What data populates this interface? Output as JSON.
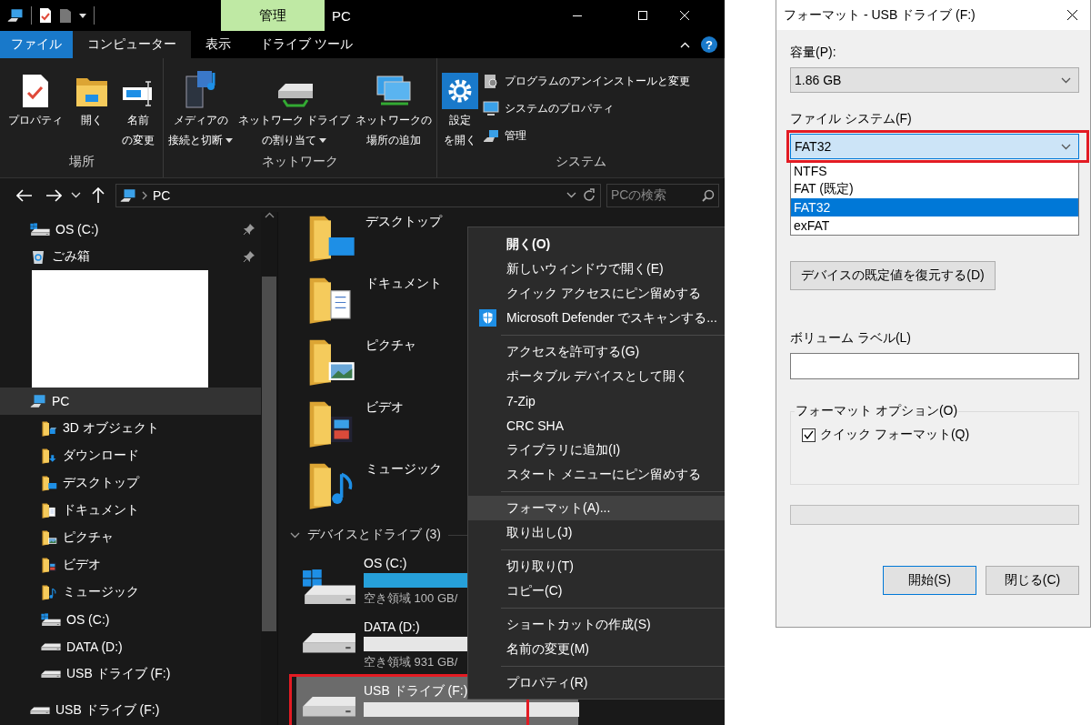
{
  "window": {
    "title": "PC",
    "context_tab": "管理",
    "help": "?"
  },
  "tabs": [
    {
      "label": "ファイル",
      "kind": "file",
      "selected": false
    },
    {
      "label": "コンピューター",
      "kind": "tab",
      "selected": true
    },
    {
      "label": "表示",
      "kind": "tab",
      "selected": false
    },
    {
      "label": "ドライブ ツール",
      "kind": "tab",
      "selected": false
    }
  ],
  "ribbon": {
    "groups": [
      {
        "label": "場所",
        "items": [
          {
            "kind": "properties",
            "lines": [
              "プロパティ"
            ],
            "dropdown": false
          },
          {
            "kind": "open",
            "lines": [
              "開く"
            ],
            "dropdown": false
          },
          {
            "kind": "rename",
            "lines": [
              "名前",
              "の変更"
            ],
            "dropdown": false
          }
        ]
      },
      {
        "label": "ネットワーク",
        "items": [
          {
            "kind": "media",
            "lines": [
              "メディアの",
              "接続と切断"
            ],
            "dropdown": true
          },
          {
            "kind": "netdrive",
            "lines": [
              "ネットワーク ドライブ",
              "の割り当て"
            ],
            "dropdown": true
          },
          {
            "kind": "netlocation",
            "lines": [
              "ネットワークの",
              "場所の追加"
            ],
            "dropdown": false
          }
        ]
      },
      {
        "label": "システム",
        "items": [
          {
            "kind": "settings",
            "lines": [
              "設定",
              "を開く"
            ],
            "dropdown": false
          }
        ],
        "small_items": [
          {
            "kind": "programs",
            "label": "プログラムのアンインストールと変更"
          },
          {
            "kind": "system",
            "label": "システムのプロパティ"
          },
          {
            "kind": "manage",
            "label": "管理"
          }
        ]
      }
    ]
  },
  "address": {
    "path": "PC",
    "search_placeholder": "PCの検索"
  },
  "nav": {
    "items": [
      {
        "label": "OS (C:)",
        "kind": "osdrive",
        "pinned": true,
        "selected": false
      },
      {
        "label": "ごみ箱",
        "kind": "recycle",
        "pinned": true,
        "selected": false
      },
      {
        "label": "PC",
        "kind": "pc",
        "pinned": false,
        "selected": true,
        "children": [
          {
            "label": "3D オブジェクト",
            "kind": "objects",
            "pinned": false,
            "selected": false
          },
          {
            "label": "ダウンロード",
            "kind": "download",
            "pinned": false,
            "selected": false
          },
          {
            "label": "デスクトップ",
            "kind": "desktop",
            "pinned": false,
            "selected": false
          },
          {
            "label": "ドキュメント",
            "kind": "documents",
            "pinned": false,
            "selected": false
          },
          {
            "label": "ピクチャ",
            "kind": "pictures",
            "pinned": false,
            "selected": false
          },
          {
            "label": "ビデオ",
            "kind": "videos",
            "pinned": false,
            "selected": false
          },
          {
            "label": "ミュージック",
            "kind": "music",
            "pinned": false,
            "selected": false
          },
          {
            "label": "OS (C:)",
            "kind": "osdrive",
            "pinned": false,
            "selected": false
          },
          {
            "label": "DATA (D:)",
            "kind": "drive",
            "pinned": false,
            "selected": false
          },
          {
            "label": "USB ドライブ (F:)",
            "kind": "drive",
            "pinned": false,
            "selected": false
          }
        ]
      },
      {
        "label": "USB ドライブ (F:)",
        "kind": "drive",
        "pinned": false,
        "selected": false
      }
    ]
  },
  "content": {
    "folders": [
      {
        "label": "デスクトップ",
        "kind": "desktop",
        "selected": false
      },
      {
        "label": "ドキュメント",
        "kind": "documents",
        "selected": false
      },
      {
        "label": "ピクチャ",
        "kind": "pictures",
        "selected": false
      },
      {
        "label": "ビデオ",
        "kind": "videos",
        "selected": false
      },
      {
        "label": "ミュージック",
        "kind": "music",
        "selected": false
      }
    ],
    "section": {
      "label": "デバイスとドライブ (3)",
      "expanded": true
    },
    "drives": [
      {
        "name": "OS (C:)",
        "kind": "osdrive",
        "level": 0.9,
        "free": "空き領域 100 GB/",
        "selected": false
      },
      {
        "name": "DATA (D:)",
        "kind": "drive",
        "free": "空き領域 931 GB/",
        "selected": false
      },
      {
        "name": "USB ドライブ (F:)",
        "kind": "drive",
        "selected": true
      }
    ]
  },
  "context_menu": {
    "groups": [
      {
        "items": [
          {
            "label": "開く(O)",
            "kind": "plain",
            "bold": true,
            "selected": false
          },
          {
            "label": "新しいウィンドウで開く(E)",
            "kind": "plain",
            "bold": false,
            "selected": false
          },
          {
            "label": "クイック アクセスにピン留めする",
            "kind": "plain",
            "bold": false,
            "selected": false
          },
          {
            "label": "Microsoft Defender でスキャンする...",
            "kind": "shield",
            "bold": false,
            "selected": false
          }
        ]
      },
      {
        "items": [
          {
            "label": "アクセスを許可する(G)",
            "kind": "plain",
            "bold": false,
            "selected": false
          },
          {
            "label": "ポータブル デバイスとして開く",
            "kind": "plain",
            "bold": false,
            "selected": false
          },
          {
            "label": "7-Zip",
            "kind": "plain",
            "bold": false,
            "selected": false
          },
          {
            "label": "CRC SHA",
            "kind": "plain",
            "bold": false,
            "selected": false
          },
          {
            "label": "ライブラリに追加(I)",
            "kind": "plain",
            "bold": false,
            "selected": false
          },
          {
            "label": "スタート メニューにピン留めする",
            "kind": "plain",
            "bold": false,
            "selected": false
          }
        ]
      },
      {
        "items": [
          {
            "label": "フォーマット(A)...",
            "kind": "plain",
            "bold": false,
            "selected": true
          },
          {
            "label": "取り出し(J)",
            "kind": "plain",
            "bold": false,
            "selected": false
          }
        ]
      },
      {
        "items": [
          {
            "label": "切り取り(T)",
            "kind": "plain",
            "bold": false,
            "selected": false
          },
          {
            "label": "コピー(C)",
            "kind": "plain",
            "bold": false,
            "selected": false
          }
        ]
      },
      {
        "items": [
          {
            "label": "ショートカットの作成(S)",
            "kind": "plain",
            "bold": false,
            "selected": false
          },
          {
            "label": "名前の変更(M)",
            "kind": "plain",
            "bold": false,
            "selected": false
          }
        ]
      },
      {
        "items": [
          {
            "label": "プロパティ(R)",
            "kind": "plain",
            "bold": false,
            "selected": false
          }
        ]
      }
    ]
  },
  "dialog": {
    "title": "フォーマット - USB ドライブ (F:)",
    "capacity": {
      "label": "容量(P):",
      "value": "1.86 GB"
    },
    "file_system": {
      "label": "ファイル システム(F)",
      "value": "FAT32",
      "open": true,
      "options": [
        {
          "label": "NTFS",
          "selected": false
        },
        {
          "label": "FAT (既定)",
          "selected": false
        },
        {
          "label": "FAT32",
          "selected": true
        },
        {
          "label": "exFAT",
          "selected": false
        }
      ]
    },
    "restore_button": "デバイスの既定値を復元する(D)",
    "volume_label": {
      "label": "ボリューム ラベル(L)"
    },
    "options": {
      "label": "フォーマット オプション(O)",
      "quick_format": {
        "label": "クイック フォーマット(Q)",
        "checked": true
      }
    },
    "progress": {
      "level": 0
    },
    "buttons": [
      {
        "label": "開始(S)",
        "default": true
      },
      {
        "label": "閉じる(C)",
        "default": false
      }
    ]
  }
}
